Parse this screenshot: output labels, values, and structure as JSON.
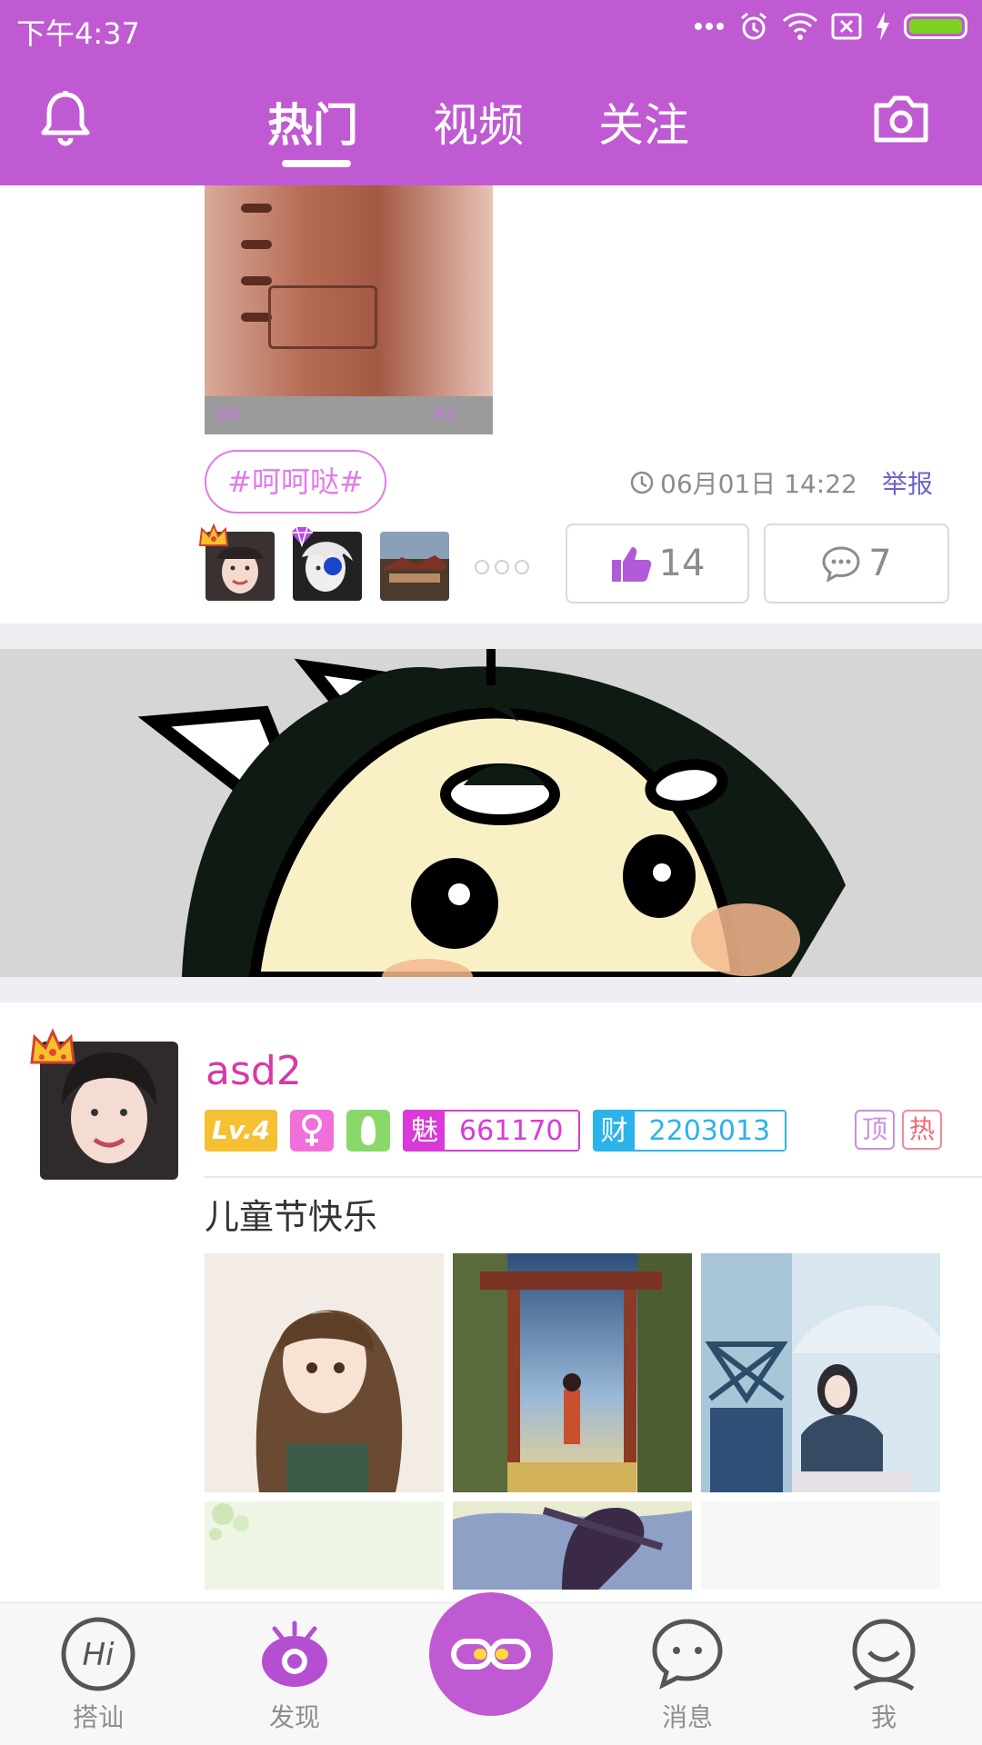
{
  "status_bar": {
    "time": "下午4:37"
  },
  "header": {
    "tabs": [
      {
        "label": "热门",
        "active": true
      },
      {
        "label": "视频",
        "active": false
      },
      {
        "label": "关注",
        "active": false
      }
    ],
    "accent_color": "#c05ad2"
  },
  "post1": {
    "image_caption_left": "原图",
    "image_caption_right": "更多",
    "tag": "#呵呵哒#",
    "time": "06月01日 14:22",
    "report_label": "举报",
    "likes": "14",
    "comments": "7"
  },
  "post2": {
    "username": "asd2",
    "level": "Lv.4",
    "charm_key": "魅",
    "charm_value": "661170",
    "wealth_key": "财",
    "wealth_value": "2203013",
    "flag_top": "顶",
    "flag_hot": "热",
    "text": "儿童节快乐"
  },
  "bottom_nav": {
    "items": [
      {
        "label": "搭讪",
        "icon": "hi-icon"
      },
      {
        "label": "发现",
        "icon": "eye-icon"
      },
      {
        "label": "",
        "icon": "link-icon"
      },
      {
        "label": "消息",
        "icon": "chat-icon"
      },
      {
        "label": "我",
        "icon": "profile-icon"
      }
    ]
  }
}
